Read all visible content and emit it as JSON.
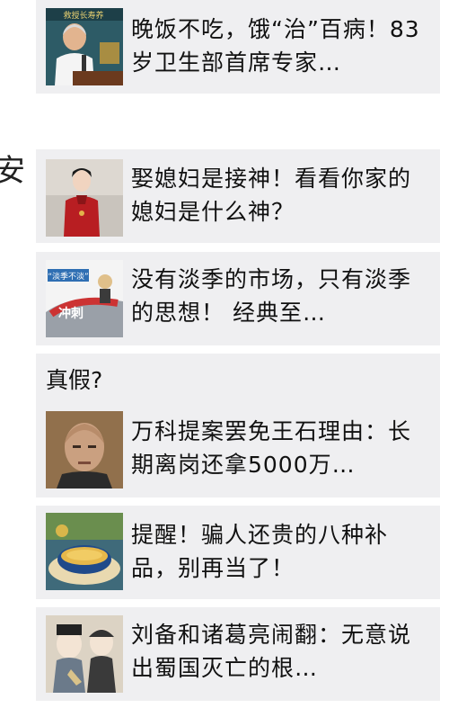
{
  "feed": {
    "items": [
      {
        "title": "晚饭不吃，饿“治”百病！83岁卫生部首席专家…",
        "thumb_icon": "speaker-at-podium-photo"
      },
      {
        "title": "娶媳妇是接神！看看你家的媳妇是什么神？",
        "thumb_icon": "woman-in-red-dress-photo"
      },
      {
        "title": "没有淡季的市场，只有淡季的思想！ 经典至…",
        "thumb_icon": "sales-slogan-illustration",
        "thumb_text": "冲刺",
        "thumb_caption": "“淡季不淡”"
      },
      {
        "title": "万科提案罢免王石理由：长期离岗还拿5000万…",
        "thumb_icon": "bald-man-portrait-photo"
      },
      {
        "title": "提醒！骗人还贵的八种补品，别再当了！",
        "thumb_icon": "soup-bowl-photo"
      },
      {
        "title": "刘备和诸葛亮闹翻：无意说出蜀国灭亡的根…",
        "thumb_icon": "three-kingdoms-cartoon"
      }
    ],
    "section_label": "真假?",
    "edge_glyph": "安"
  }
}
